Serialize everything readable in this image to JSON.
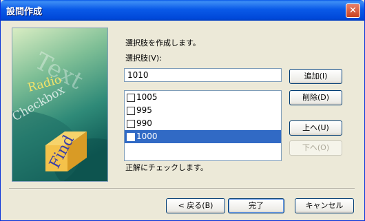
{
  "window": {
    "title": "設問作成",
    "close_glyph": "✕"
  },
  "illustration": {
    "words": [
      "Text",
      "Radio",
      "Checkbox",
      "Find"
    ]
  },
  "main": {
    "description": "選択肢を作成します。",
    "choice_label": "選択肢(V):",
    "choice_value": "1010",
    "add_button": "追加(I)",
    "delete_button": "削除(D)",
    "up_button": "上へ(U)",
    "down_button": "下へ(O)",
    "items": [
      {
        "label": "1005",
        "checked": false,
        "selected": false
      },
      {
        "label": "995",
        "checked": false,
        "selected": false
      },
      {
        "label": "990",
        "checked": false,
        "selected": false
      },
      {
        "label": "1000",
        "checked": false,
        "selected": true
      }
    ],
    "note": "正解にチェックします。"
  },
  "footer": {
    "back_button": "< 戻る(B)",
    "finish_button": "完了",
    "cancel_button": "キャンセル"
  },
  "colors": {
    "titlebar": "#0a5ae8",
    "selection": "#316ac5",
    "face": "#ece9d8"
  }
}
